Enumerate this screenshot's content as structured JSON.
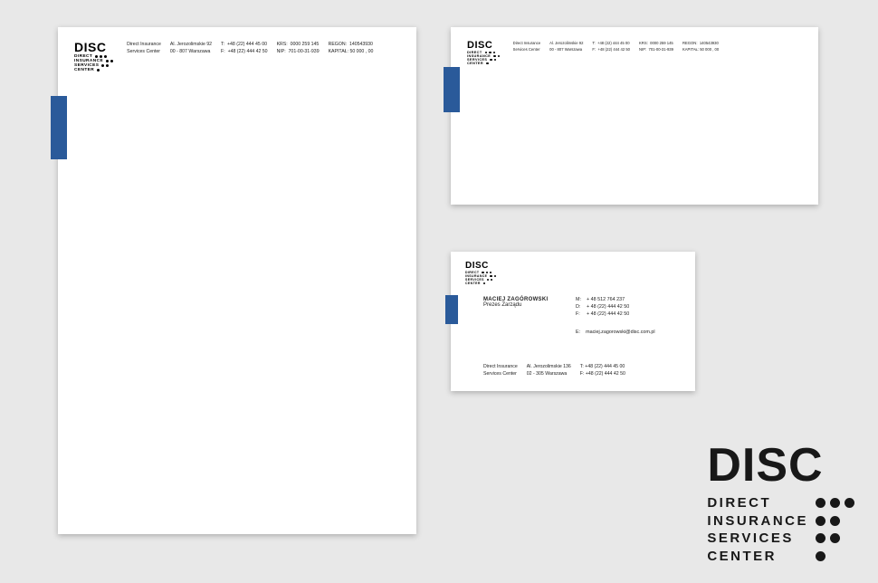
{
  "brand": {
    "acronym": "DISC",
    "words": [
      "DIRECT",
      "INSURANCE",
      "SERVICES",
      "CENTER"
    ],
    "dot_pattern": [
      [
        1,
        1,
        1
      ],
      [
        1,
        1,
        0
      ],
      [
        1,
        1,
        0
      ],
      [
        1,
        0,
        0
      ]
    ],
    "accent_color": "#2a5a9a"
  },
  "company": {
    "line1": "Direct Insurance",
    "line2": "Services Center"
  },
  "address": {
    "line1": "Al. Jerozolimskie 92",
    "line2": "00 - 807  Warszawa"
  },
  "phones": {
    "t_label": "T:",
    "f_label": "F:",
    "t": "+48 (22) 444 45 00",
    "f": "+48 (22) 444 42 50"
  },
  "ids": {
    "krs_label": "KRS:",
    "nip_label": "NIP:",
    "regon_label": "REGON:",
    "kapital_label": "KAPITAŁ:",
    "krs": "0000 259 145",
    "nip": "701-00-31-939",
    "regon": "140543930",
    "kapital": "50 000 , 00"
  },
  "bcard": {
    "name": "MACIEJ  ZAGÓROWSKI",
    "title": "Prezes Zarządu",
    "m_label": "M:",
    "d_label": "D:",
    "f_label": "F:",
    "e_label": "E:",
    "m": "+ 48 512 764 237",
    "d": "+ 48 (22) 444 42 50",
    "f": "+ 48 (22) 444 42 50",
    "email": "maciej.zagorowski@disc.com.pl",
    "addr_line1": "Al. Jerozolimskie 136",
    "addr_line2": "02 - 305  Warszawa",
    "footer_t": "+48 (22) 444 45 00",
    "footer_f": "+48 (22) 444 42 50"
  }
}
